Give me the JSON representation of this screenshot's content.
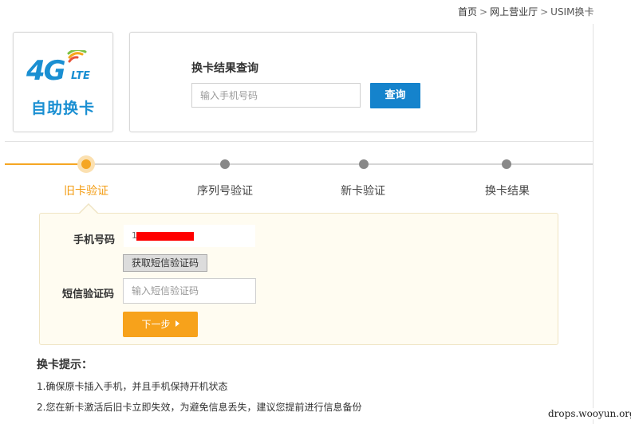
{
  "breadcrumb": {
    "home": "首页",
    "sep1": ">",
    "hall": "网上营业厅",
    "sep2": ">",
    "current": "USIM换卡"
  },
  "logo": {
    "badge_4g": "4G",
    "badge_lte": "LTE",
    "title": "自助换卡"
  },
  "query": {
    "title": "换卡结果查询",
    "input_placeholder": "输入手机号码",
    "button_label": "查询"
  },
  "steps": [
    {
      "label": "旧卡验证",
      "state": "active"
    },
    {
      "label": "序列号验证",
      "state": "pending"
    },
    {
      "label": "新卡验证",
      "state": "pending"
    },
    {
      "label": "换卡结果",
      "state": "pending"
    }
  ],
  "form": {
    "phone_label": "手机号码",
    "phone_value": "1",
    "get_code_button": "获取短信验证码",
    "sms_label": "短信验证码",
    "sms_placeholder": "输入短信验证码",
    "next_button": "下一步"
  },
  "tips": {
    "title": "换卡提示：",
    "items": [
      "1.确保原卡插入手机，并且手机保持开机状态",
      "2.您在新卡激活后旧卡立即失效，为避免信息丢失，建议您提前进行信息备份"
    ]
  },
  "watermark": "drops.wooyun.org",
  "colors": {
    "brand_blue": "#1583cc",
    "accent_orange": "#f7a21b",
    "panel_bg": "#fffcf1"
  }
}
